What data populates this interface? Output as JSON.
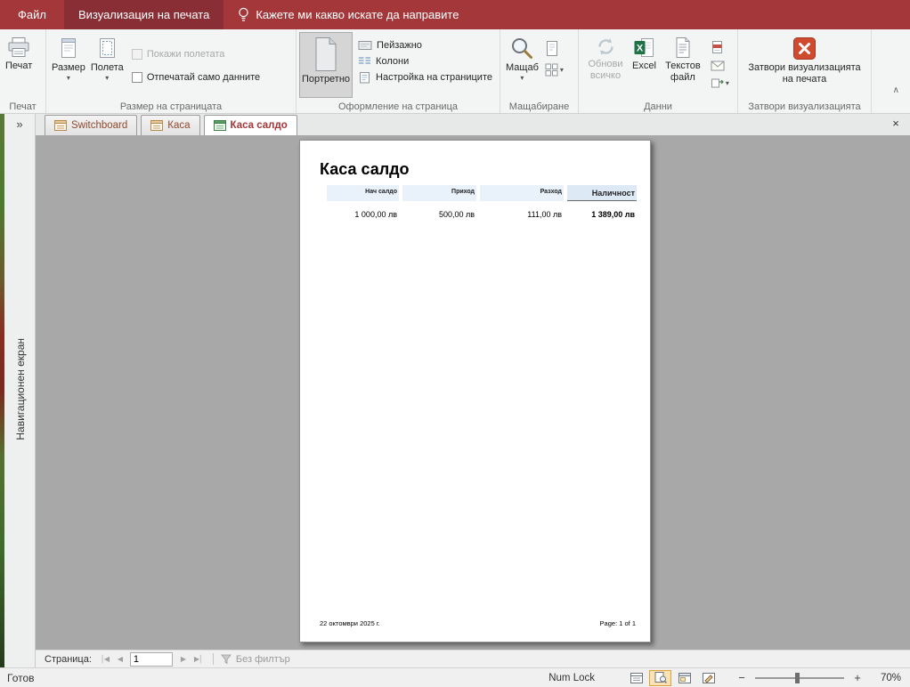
{
  "icons": {
    "caret": "▾",
    "pane_expand": "»",
    "ribbon_collapse": "∧",
    "tab_close": "×",
    "nav_first": "│◀",
    "nav_prev": "◀",
    "nav_next": "▶",
    "nav_last": "▶│",
    "zoom_out": "−",
    "zoom_in": "+"
  },
  "colors": {
    "accent": "#a4373a",
    "active_ribbon_tab": "#8a2e35",
    "selected_view_highlight": "#fbe2b5"
  },
  "titlebar": {
    "file_tab": "Файл",
    "preview_tab": "Визуализация на печата",
    "tell_me": "Кажете ми какво искате да направите"
  },
  "ribbon": {
    "print": {
      "label": "Печат",
      "print_button": "Печат"
    },
    "page_size": {
      "label": "Размер на страницата",
      "size_button": "Размер",
      "margins_button": "Полета",
      "show_margins": "Покажи полетата",
      "data_only": "Отпечатай само данните"
    },
    "page_layout": {
      "label": "Оформление на страница",
      "portrait": "Портретно",
      "landscape": "Пейзажно",
      "columns": "Колони",
      "page_setup": "Настройка на страниците"
    },
    "zoom": {
      "label": "Мащабиране",
      "zoom_button": "Мащаб"
    },
    "data": {
      "label": "Данни",
      "refresh_all": "Обнови всичко",
      "excel": "Excel",
      "text_file": "Текстов файл"
    },
    "close": {
      "label": "Затвори визуализацията",
      "close_button": "Затвори визуализацията на печата"
    }
  },
  "doc_tabs": [
    {
      "label": "Switchboard"
    },
    {
      "label": "Каса"
    },
    {
      "label": "Каса салдо"
    }
  ],
  "sidebar": {
    "title": "Навигационен екран"
  },
  "report": {
    "title": "Каса салдо",
    "columns": [
      "Нач салдо",
      "Приход",
      "Разход",
      "Наличност"
    ],
    "values": [
      "1 000,00 лв",
      "500,00 лв",
      "111,00 лв",
      "1 389,00 лв"
    ],
    "footer_date": "22 октомври 2025 г.",
    "footer_page": "Page: 1 of 1"
  },
  "pager": {
    "label": "Страница:",
    "page": "1",
    "filter": "Без филтър"
  },
  "statusbar": {
    "ready": "Готов",
    "numlock": "Num Lock",
    "zoom": "70%"
  }
}
